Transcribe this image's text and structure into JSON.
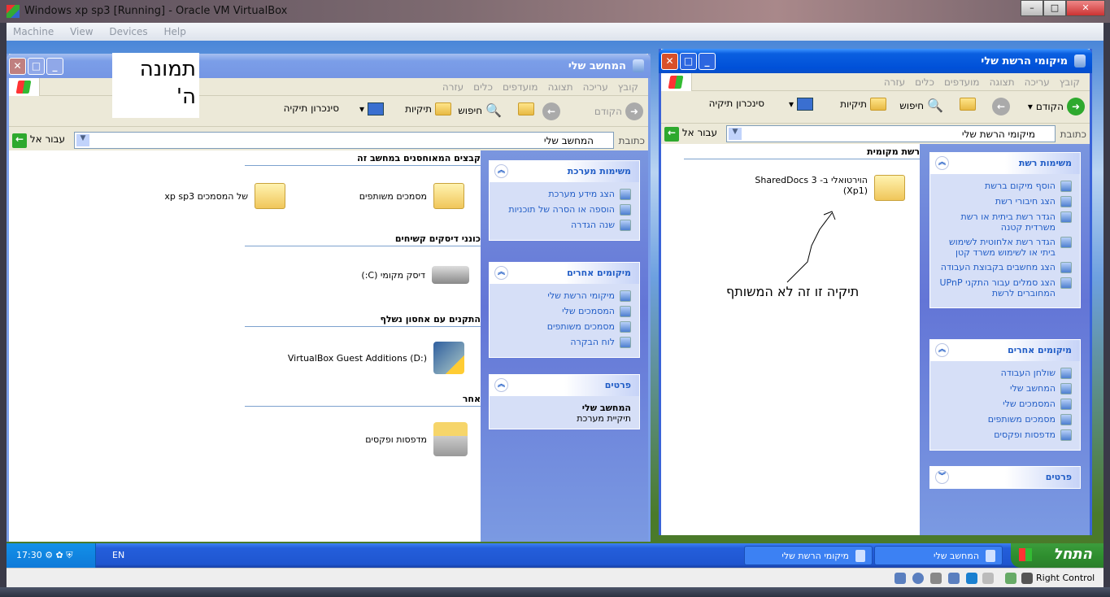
{
  "vbox": {
    "title": "Windows xp sp3 [Running] - Oracle VM VirtualBox",
    "menu": [
      "Machine",
      "View",
      "Devices",
      "Help"
    ],
    "status_right": "Right Control"
  },
  "annotation": {
    "label_line1": "תמונה",
    "label_line2": "ה'",
    "note": "תיקיה זו זה לא המשותף"
  },
  "left_window": {
    "title": "המחשב שלי",
    "menu": [
      "קובץ",
      "עריכה",
      "תצוגה",
      "מועדפים",
      "כלים",
      "עזרה"
    ],
    "toolbar": {
      "back": "הקודם",
      "search": "חיפוש",
      "folders": "תיקיות",
      "sync": "סינכרון תיקיה"
    },
    "address": {
      "label": "כתובת",
      "value": "המחשב שלי",
      "go": "עבור אל"
    },
    "groups": [
      {
        "title": "קבצים המאוחסנים במחשב זה",
        "items": [
          "מסמכים משותפים",
          "של המסמכים xp sp3"
        ]
      },
      {
        "title": "כונני דיסקים קשיחים",
        "items": [
          "דיסק מקומי (C:)"
        ]
      },
      {
        "title": "התקנים עם אחסון נשלף",
        "items": [
          "VirtualBox Guest Additions (D:)"
        ]
      },
      {
        "title": "אחר",
        "items": [
          "מדפסות ופקסים"
        ]
      }
    ],
    "tasks": {
      "title": "משימות מערכת",
      "links": [
        "הצג מידע מערכת",
        "הוספה או הסרה של תוכניות",
        "שנה הגדרה"
      ]
    },
    "other": {
      "title": "מיקומים אחרים",
      "links": [
        "מיקומי הרשת שלי",
        "המסמכים שלי",
        "מסמכים משותפים",
        "לוח הבקרה"
      ]
    },
    "details": {
      "title": "פרטים",
      "name": "המחשב שלי",
      "type": "תיקיית מערכת"
    }
  },
  "right_window": {
    "title": "מיקומי הרשת שלי",
    "menu": [
      "קובץ",
      "עריכה",
      "תצוגה",
      "מועדפים",
      "כלים",
      "עזרה"
    ],
    "toolbar": {
      "back": "הקודם",
      "search": "חיפוש",
      "folders": "תיקיות",
      "sync": "סינכרון תיקיה"
    },
    "address": {
      "label": "כתובת",
      "value": "מיקומי הרשת שלי",
      "go": "עבור אל"
    },
    "group": "רשת מקומית",
    "folder_line1": "הוירטואלי ב- SharedDocs 3",
    "folder_line2": "(Xp1)",
    "tasks": {
      "title": "משימות רשת",
      "links": [
        "הוסף מיקום ברשת",
        "הצג חיבורי רשת",
        "הגדר רשת ביתית או רשת משרדית קטנה",
        "הגדר רשת אלחוטית לשימוש ביתי או לשימוש משרד קטן",
        "הצג מחשבים בקבוצת העבודה",
        "הצג סמלים עבור התקני UPnP המחוברים לרשת"
      ]
    },
    "other": {
      "title": "מיקומים אחרים",
      "links": [
        "שולחן העבודה",
        "המחשב שלי",
        "המסמכים שלי",
        "מסמכים משותפים",
        "מדפסות ופקסים"
      ]
    },
    "details": {
      "title": "פרטים"
    }
  },
  "taskbar": {
    "start": "התחל",
    "buttons": [
      "המחשב שלי",
      "מיקומי הרשת שלי"
    ],
    "lang": "EN",
    "clock": "17:30"
  }
}
